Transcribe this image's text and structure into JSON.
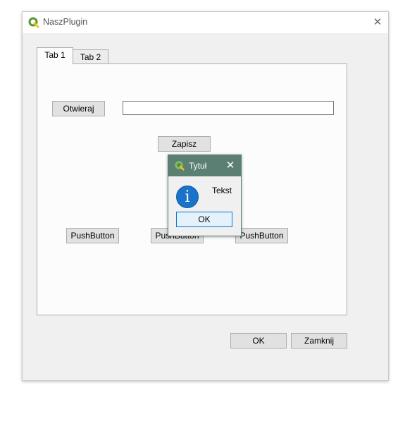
{
  "window": {
    "title": "NaszPlugin",
    "close_glyph": "✕",
    "icon": "qgis-logo-icon"
  },
  "tabs": [
    {
      "label": "Tab 1",
      "active": true
    },
    {
      "label": "Tab 2",
      "active": false
    }
  ],
  "tab1": {
    "open_button": "Otwieraj",
    "text_field_value": "",
    "save_button": "Zapisz",
    "push_buttons": [
      "PushButton",
      "PushButton",
      "PushButton"
    ]
  },
  "footer": {
    "ok_button": "OK",
    "close_button": "Zamknij"
  },
  "message_box": {
    "title": "Tytuł",
    "close_glyph": "✕",
    "icon": "information-icon",
    "info_glyph": "i",
    "text": "Tekst",
    "ok_button": "OK"
  },
  "colors": {
    "message_titlebar": "#5b7f73",
    "qgis_green": "#589632",
    "info_blue": "#1a73c9",
    "default_button_border": "#0078d7"
  }
}
